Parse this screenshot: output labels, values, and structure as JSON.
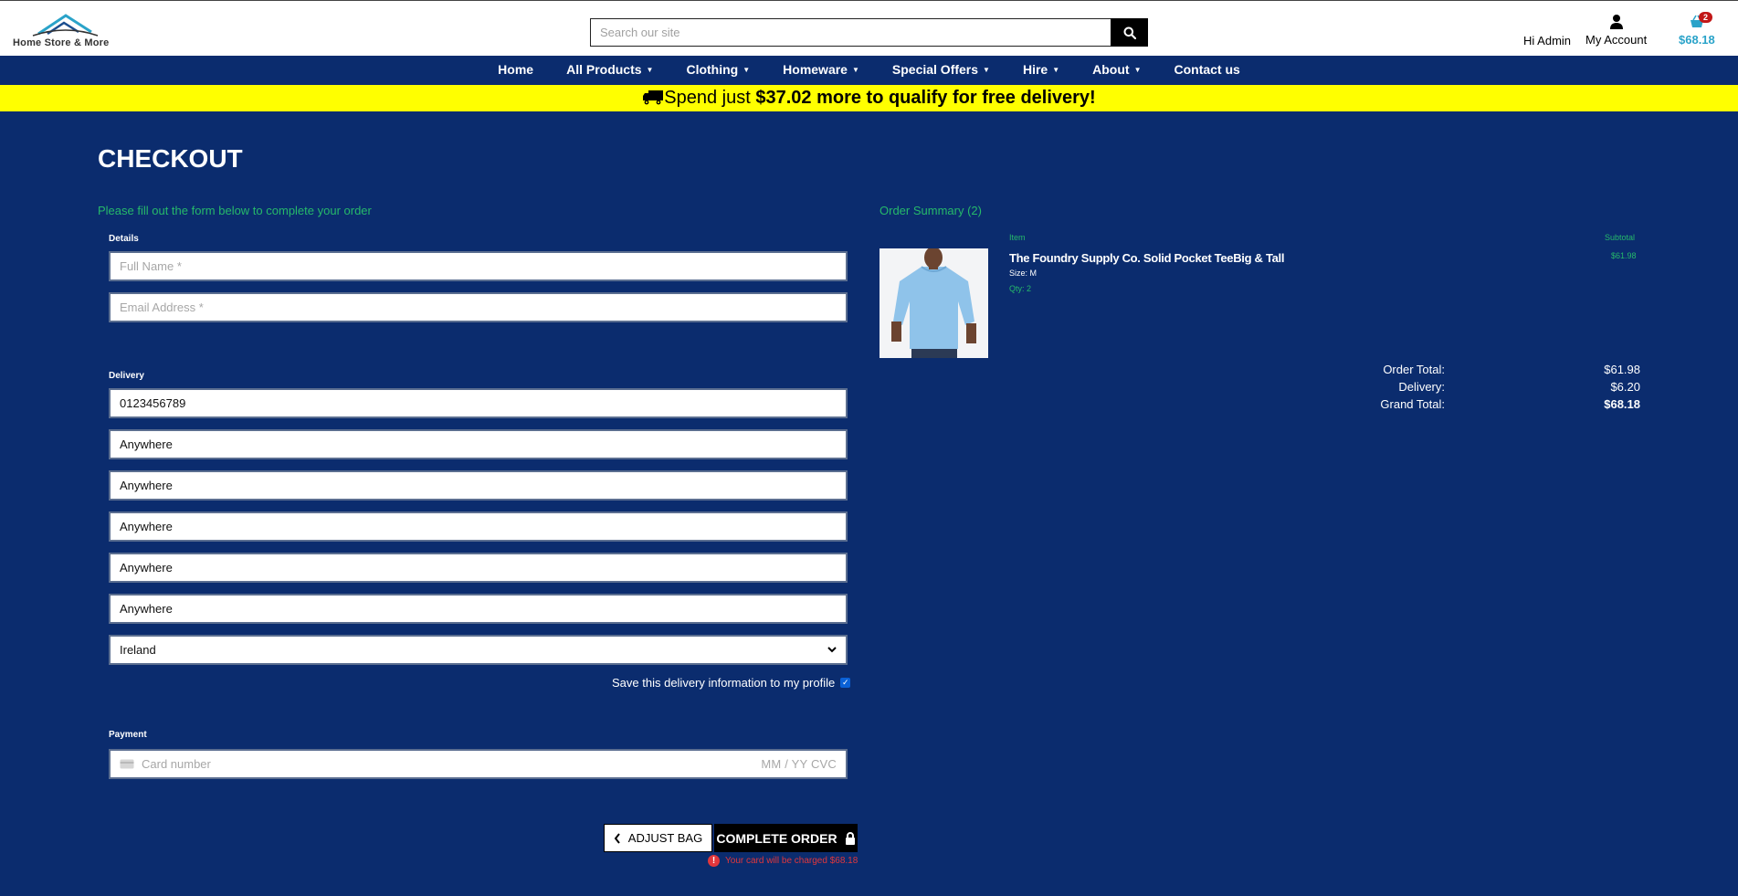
{
  "header": {
    "logo_text": "Home Store & More",
    "search_placeholder": "Search our site",
    "greeting": "Hi Admin",
    "account_label": "My Account",
    "cart_count": "2",
    "cart_total": "$68.18"
  },
  "nav": {
    "items": [
      {
        "label": "Home",
        "dropdown": false
      },
      {
        "label": "All Products",
        "dropdown": true
      },
      {
        "label": "Clothing",
        "dropdown": true
      },
      {
        "label": "Homeware",
        "dropdown": true
      },
      {
        "label": "Special Offers",
        "dropdown": true
      },
      {
        "label": "Hire",
        "dropdown": true
      },
      {
        "label": "About",
        "dropdown": true
      },
      {
        "label": "Contact us",
        "dropdown": false
      }
    ]
  },
  "banner": {
    "prefix": "Spend just ",
    "amount_text": "$37.02 more to qualify for free delivery!"
  },
  "checkout": {
    "title": "CHECKOUT",
    "intro": "Please fill out the form below to complete your order",
    "details_label": "Details",
    "full_name_placeholder": "Full Name *",
    "email_placeholder": "Email Address *",
    "delivery_label": "Delivery",
    "phone_value": "0123456789",
    "address_lines": [
      "Anywhere",
      "Anywhere",
      "Anywhere",
      "Anywhere",
      "Anywhere"
    ],
    "country_value": "Ireland",
    "save_info_label": "Save this delivery information to my profile",
    "save_info_checked": true,
    "payment_label": "Payment",
    "card_placeholder": "Card number",
    "card_expiry_cvc": "MM / YY  CVC",
    "adjust_bag_label": "ADJUST BAG",
    "complete_order_label": "COMPLETE ORDER",
    "charge_notice": "Your card will be charged $68.18"
  },
  "summary": {
    "title": "Order Summary (2)",
    "col_item": "Item",
    "col_subtotal": "Subtotal",
    "item": {
      "name": "The Foundry Supply Co. Solid Pocket TeeBig & Tall",
      "size": "Size: M",
      "qty": "Qty: 2",
      "subtotal": "$61.98"
    },
    "order_total_label": "Order Total:",
    "order_total": "$61.98",
    "delivery_label": "Delivery:",
    "delivery": "$6.20",
    "grand_total_label": "Grand Total:",
    "grand_total": "$68.18"
  },
  "colors": {
    "page_bg": "#0b2c6e",
    "banner_bg": "#ffff00",
    "accent_green": "#26b96a",
    "cart_blue": "#2aa3c9",
    "error_red": "#e1373c"
  }
}
